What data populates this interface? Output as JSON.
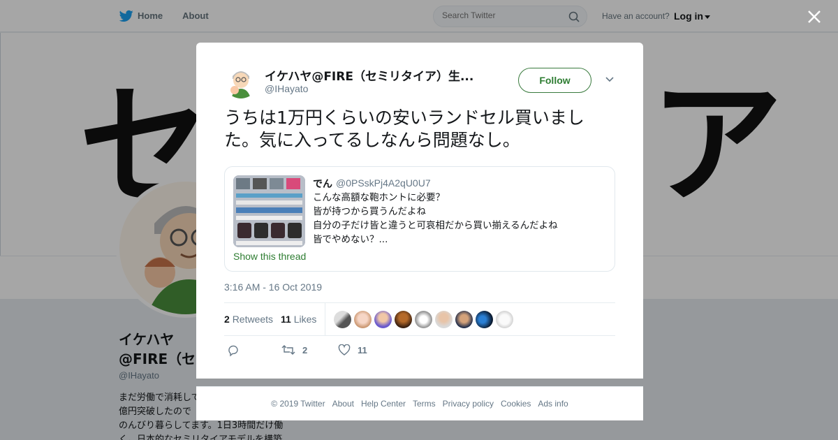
{
  "topbar": {
    "nav": [
      {
        "label": "Home"
      },
      {
        "label": "About"
      }
    ],
    "search_placeholder": "Search Twitter",
    "account_prompt": "Have an account?",
    "login_label": "Log in"
  },
  "banner": {
    "characters": [
      "セ",
      "ア"
    ]
  },
  "profile": {
    "name": "イケハヤ@FIRE（セミリタイア）生活",
    "handle": "@IHayato",
    "bio_lines": [
      "まだ労働で消耗してるの？",
      "億円突破したので",
      "のんびり暮らしてます。1日3時間だけ働",
      "く。日本的なセミリタイアモデルを構築"
    ]
  },
  "tweet": {
    "author_name": "イケハヤ@FIRE（セミリタイア）生...",
    "author_handle": "@IHayato",
    "follow_label": "Follow",
    "text": "うちは1万円くらいの安いランドセル買いました。気に入ってるしなんら問題なし。",
    "quote": {
      "name": "でん",
      "handle": "@0PSskPj4A2qU0U7",
      "lines": [
        "こんな高額な鞄ホントに必要？",
        "皆が持つから買うんだよね",
        "自分の子だけ皆と違うと可哀相だから買い揃えるんだよね",
        "皆でやめない？..."
      ],
      "show_thread": "Show this thread"
    },
    "timestamp": "3:16 AM - 16 Oct 2019",
    "retweets_count": "2",
    "retweets_label": "Retweets",
    "likes_count": "11",
    "likes_label": "Likes",
    "action_retweet_count": "2",
    "action_like_count": "11"
  },
  "footer": {
    "links": [
      "© 2019 Twitter",
      "About",
      "Help Center",
      "Terms",
      "Privacy policy",
      "Cookies",
      "Ads info"
    ]
  },
  "colors": {
    "accent": "#2e7d32",
    "overlay": "rgba(0,0,0,0.35)",
    "twitter_blue": "#1da1f2"
  },
  "icons": [
    "twitter-bird-icon",
    "search-icon",
    "close-icon",
    "chevron-down-icon",
    "reply-icon",
    "retweet-icon",
    "heart-icon"
  ]
}
